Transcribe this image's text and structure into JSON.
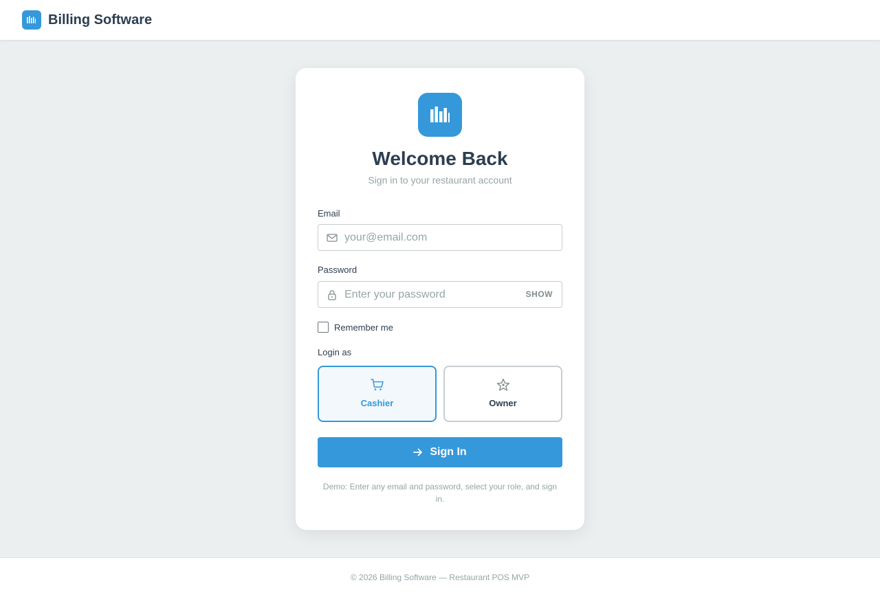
{
  "header": {
    "brand_icon": "bar-chart-icon",
    "brand_name": "Billing Software"
  },
  "card": {
    "logo_icon": "bar-chart-icon",
    "title": "Welcome Back",
    "subtitle": "Sign in to your restaurant account",
    "email": {
      "label": "Email",
      "icon": "mail-icon",
      "value": "",
      "placeholder": "your@email.com"
    },
    "password": {
      "label": "Password",
      "icon": "lock-icon",
      "value": "",
      "placeholder": "Enter your password",
      "toggle_label": "SHOW"
    },
    "remember": {
      "label": "Remember me",
      "checked": false
    },
    "login_as": {
      "label": "Login as",
      "roles": [
        {
          "label": "Cashier",
          "icon": "cart-icon",
          "selected": true
        },
        {
          "label": "Owner",
          "icon": "star-badge-icon",
          "selected": false
        }
      ]
    },
    "signin": {
      "label": "Sign In",
      "icon": "arrow-right-icon"
    },
    "demo_note": "Demo: Enter any email and password, select your role, and sign in."
  },
  "footer": {
    "text": "© 2026 Billing Software — Restaurant POS MVP"
  },
  "colors": {
    "accent": "#3498db",
    "text": "#2c3e50",
    "muted": "#95a5a6",
    "background": "#ebeff0"
  }
}
